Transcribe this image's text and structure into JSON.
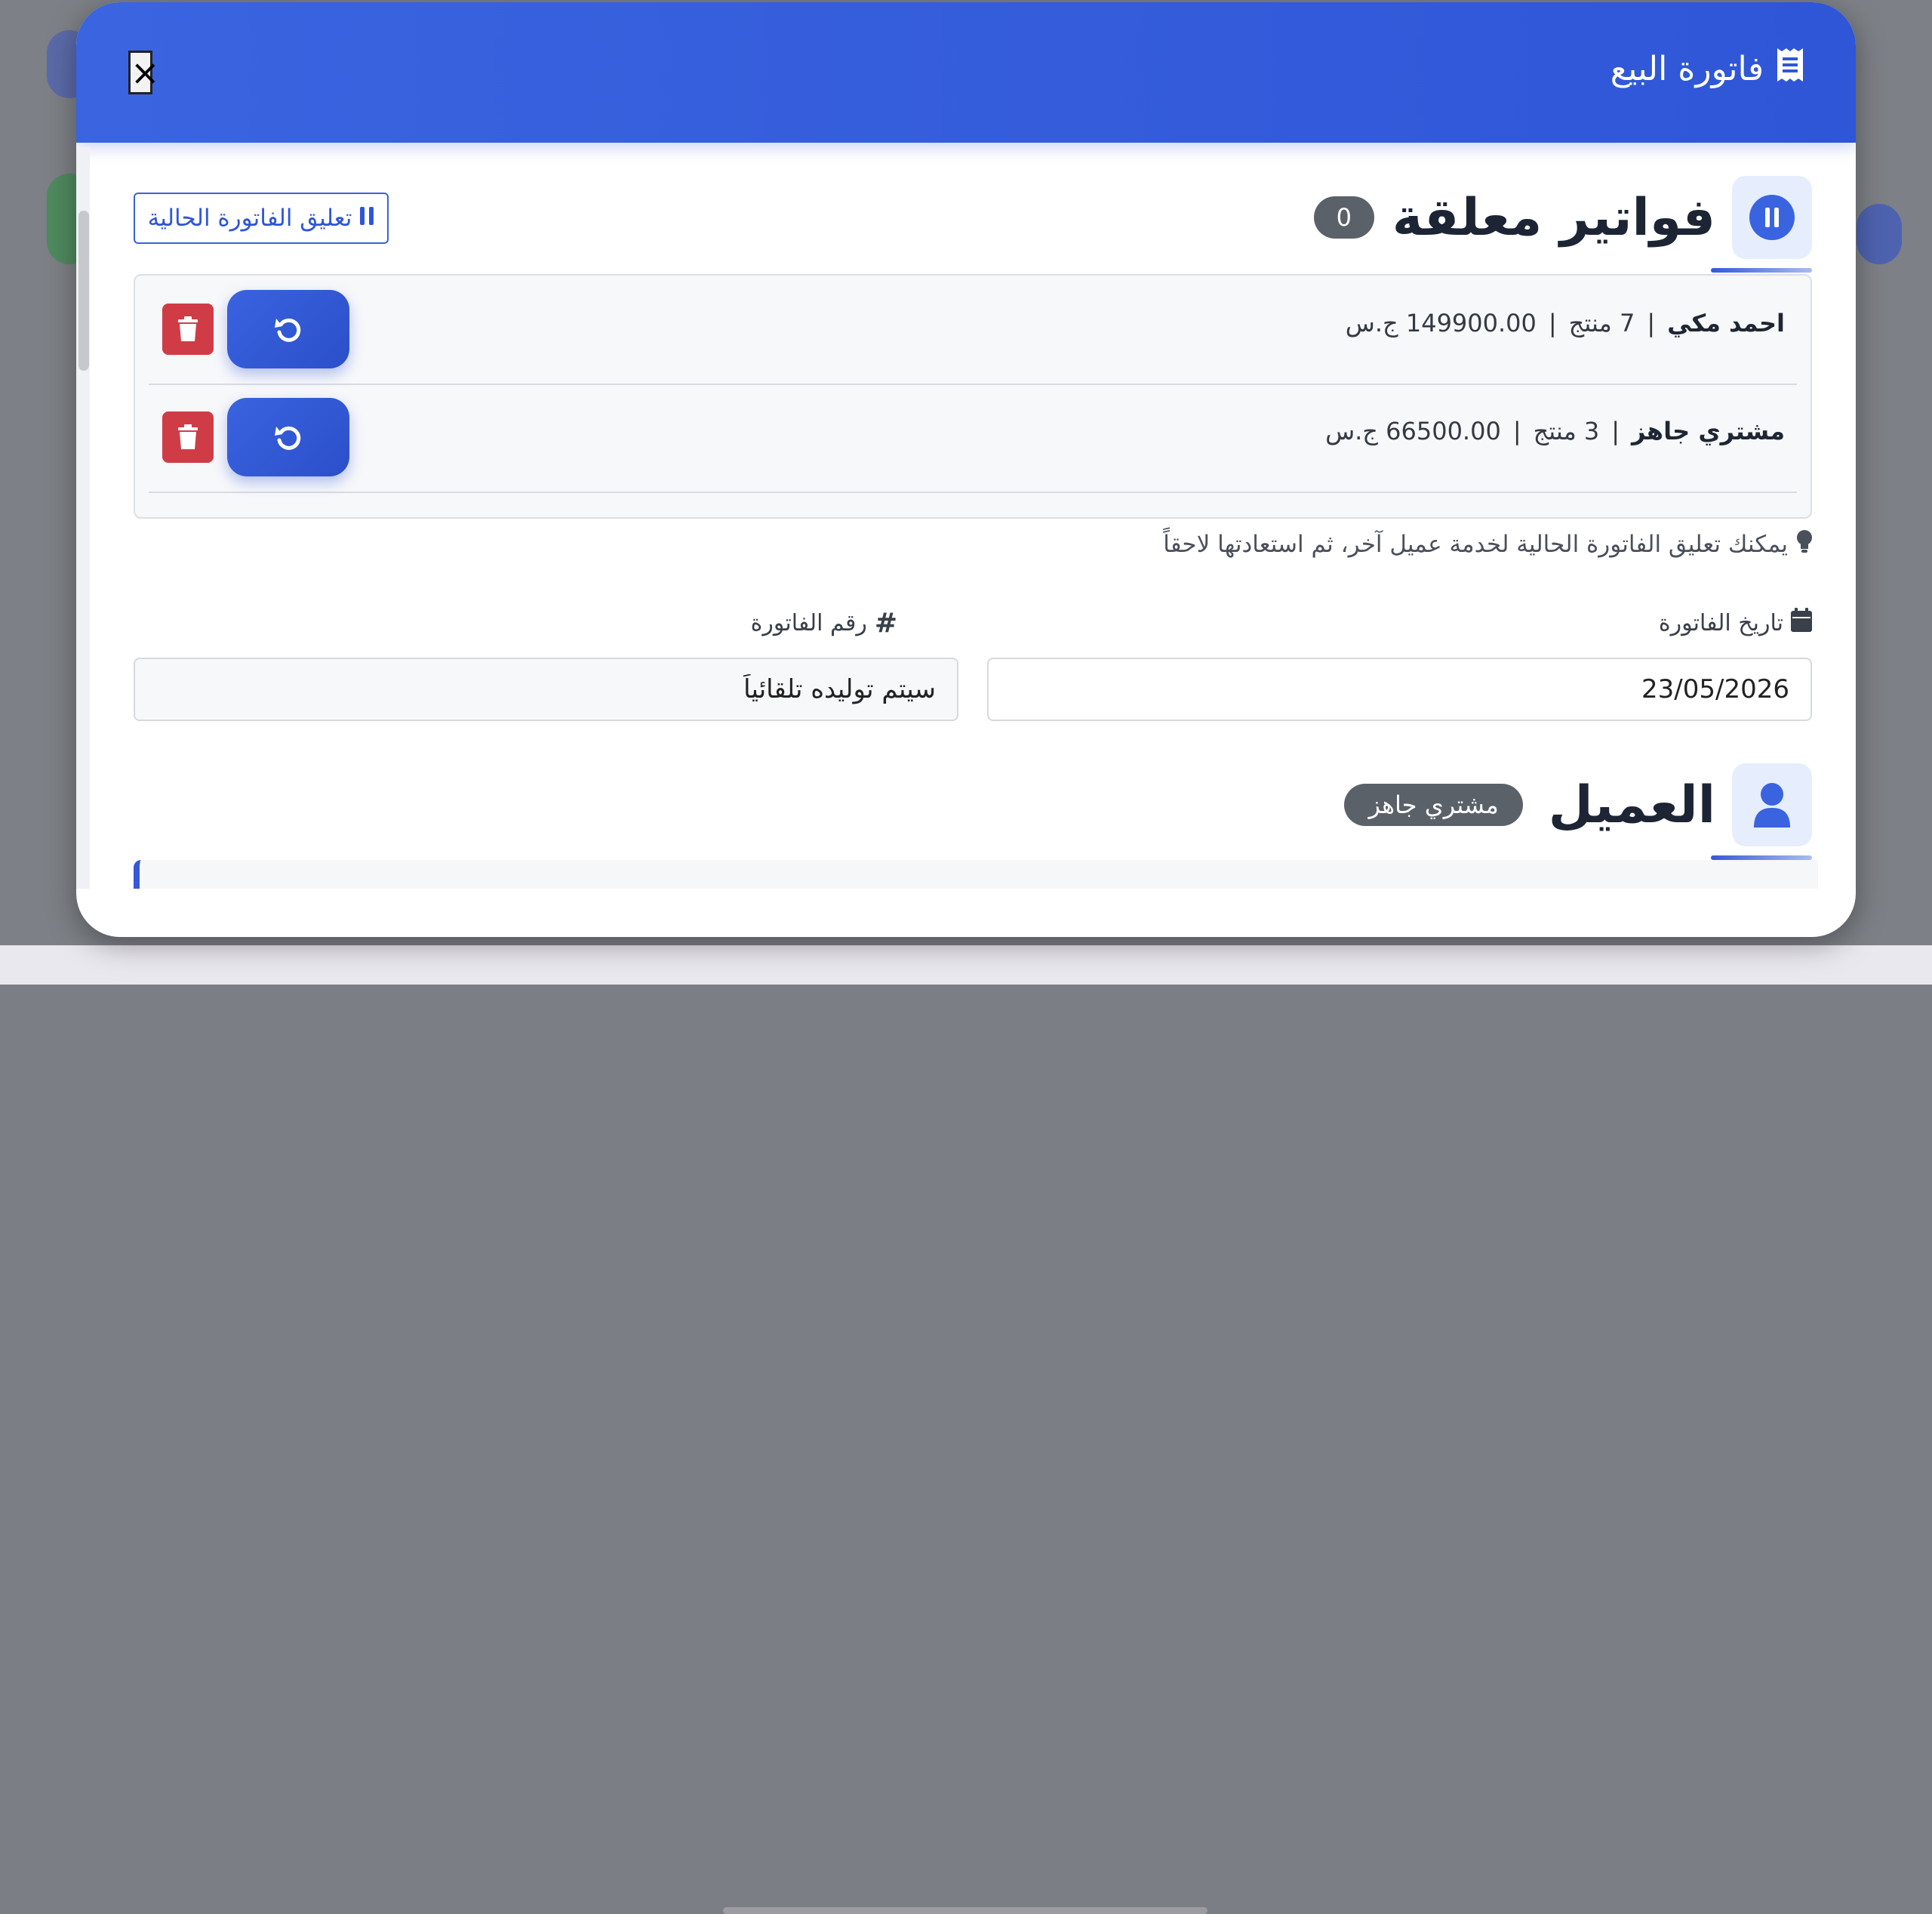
{
  "modal": {
    "title": "فاتورة البيع",
    "close_label": "×"
  },
  "held_invoices": {
    "title": "فواتير معلقة",
    "count": "0",
    "suspend_button_label": "تعليق الفاتورة الحالية",
    "rows": [
      {
        "customer": "احمد مكي",
        "items": "7 منتج",
        "total": "149900.00 ج.س"
      },
      {
        "customer": "مشتري جاهز",
        "items": "3 منتج",
        "total": "66500.00 ج.س"
      }
    ],
    "hint": "يمكنك تعليق الفاتورة الحالية لخدمة عميل آخر، ثم استعادتها لاحقاً"
  },
  "invoice": {
    "date_label": "تاريخ الفاتورة",
    "date_value": "23/05/2026",
    "number_label": "رقم الفاتورة",
    "number_value": "سيتم توليده تلقائياً"
  },
  "customer": {
    "title": "العميل",
    "selected": "مشتري جاهز"
  },
  "colors": {
    "primary": "#2f56d7",
    "danger": "#d03c46",
    "badge": "#5b6169"
  }
}
